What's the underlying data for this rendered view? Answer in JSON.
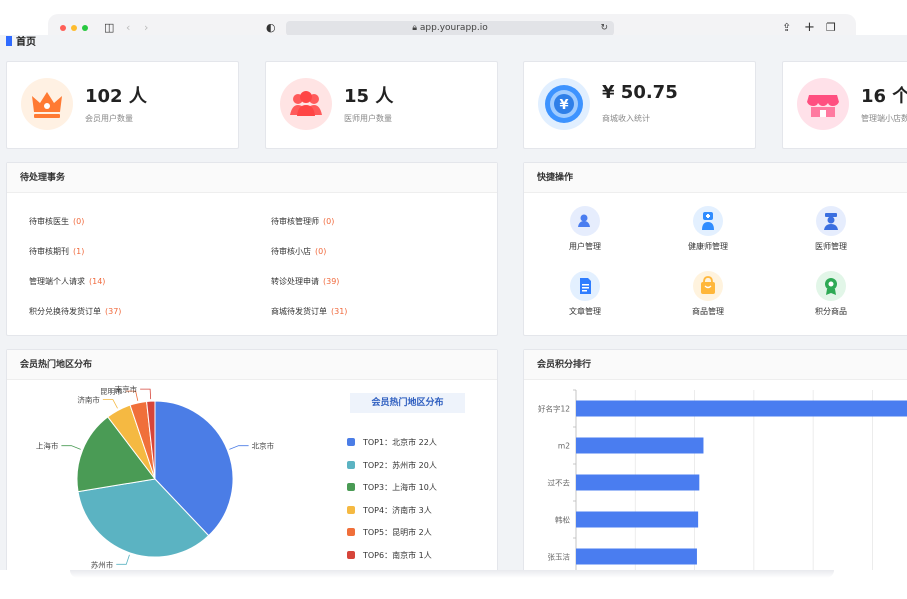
{
  "browser": {
    "url": "app.yourapp.io"
  },
  "breadcrumb": {
    "home": "首页"
  },
  "stats": [
    {
      "value": "102 人",
      "label": "会员用户数量",
      "color": "#ff8a3d"
    },
    {
      "value": "15 人",
      "label": "医师用户数量",
      "color": "#ff5a5a"
    },
    {
      "value": "¥ 50.75",
      "label": "商城收入统计",
      "color": "#2f8cff"
    },
    {
      "value": "16 个",
      "label": "管理端小店数",
      "color": "#ff5b8a"
    }
  ],
  "pending": {
    "title": "待处理事务",
    "items": [
      {
        "label": "待审核医生",
        "count": "(0)"
      },
      {
        "label": "待审核管理师",
        "count": "(0)"
      },
      {
        "label": "待审核期刊",
        "count": "(1)"
      },
      {
        "label": "待审核小店",
        "count": "(0)"
      },
      {
        "label": "管理端个人请求",
        "count": "(14)"
      },
      {
        "label": "转诊处理申请",
        "count": "(39)"
      },
      {
        "label": "积分兑换待发货订单",
        "count": "(37)"
      },
      {
        "label": "商城待发货订单",
        "count": "(31)"
      }
    ]
  },
  "quick": {
    "title": "快捷操作",
    "items": [
      {
        "label": "用户管理",
        "icon": "user-icon",
        "color": "#4a7df0"
      },
      {
        "label": "健康师管理",
        "icon": "health-worker-icon",
        "color": "#2f8cff"
      },
      {
        "label": "医师管理",
        "icon": "doctor-icon",
        "color": "#3b6fe0"
      },
      {
        "label": "文章管理",
        "icon": "document-icon",
        "color": "#2f7dff"
      },
      {
        "label": "商品管理",
        "icon": "shopping-bag-icon",
        "color": "#ffb73b"
      },
      {
        "label": "积分商品",
        "icon": "medal-icon",
        "color": "#2eaa55"
      }
    ]
  },
  "region_panel": {
    "title": "会员热门地区分布",
    "legend_title": "会员热门地区分布"
  },
  "ranking_panel": {
    "title": "会员积分排行"
  },
  "chart_data": [
    {
      "type": "pie",
      "legend": "right",
      "slices": [
        {
          "name": "北京市",
          "value": 22,
          "label": "TOP1：北京市 22人",
          "color": "#4b7de6"
        },
        {
          "name": "苏州市",
          "value": 20,
          "label": "TOP2：苏州市 20人",
          "color": "#5bb3c2"
        },
        {
          "name": "上海市",
          "value": 10,
          "label": "TOP3：上海市 10人",
          "color": "#4a9b55"
        },
        {
          "name": "济南市",
          "value": 3,
          "label": "TOP4：济南市 3人",
          "color": "#f5b942"
        },
        {
          "name": "昆明市",
          "value": 2,
          "label": "TOP5：昆明市 2人",
          "color": "#f06f3a"
        },
        {
          "name": "南京市",
          "value": 1,
          "label": "TOP6：南京市 1人",
          "color": "#d6453a"
        }
      ]
    },
    {
      "type": "bar",
      "orientation": "horizontal",
      "color": "#4a7df0",
      "categories": [
        "好名字12",
        "m2",
        "过不去",
        "韩松",
        "张玉洁"
      ],
      "values": [
        5600,
        2150,
        2080,
        2060,
        2040
      ],
      "xlim": [
        0,
        5600
      ],
      "xticks": [
        "0",
        "1,000",
        "2,000",
        "3,000",
        "4,000",
        "5,000"
      ],
      "grid": true
    }
  ]
}
